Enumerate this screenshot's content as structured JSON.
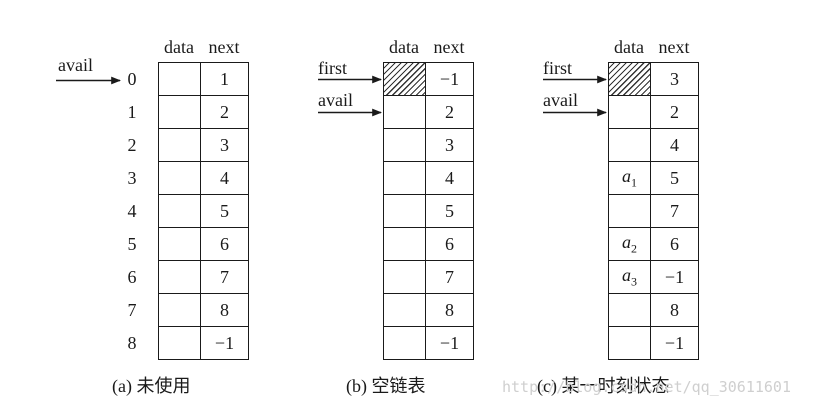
{
  "column_headers": {
    "data": "data",
    "next": "next"
  },
  "tables": [
    {
      "caption": "(a) 未使用",
      "pointers": [
        {
          "label": "avail",
          "row": 0
        }
      ],
      "show_indices": true,
      "indices": [
        "0",
        "1",
        "2",
        "3",
        "4",
        "5",
        "6",
        "7",
        "8"
      ],
      "rows": [
        {
          "data": "",
          "next": "1"
        },
        {
          "data": "",
          "next": "2"
        },
        {
          "data": "",
          "next": "3"
        },
        {
          "data": "",
          "next": "4"
        },
        {
          "data": "",
          "next": "5"
        },
        {
          "data": "",
          "next": "6"
        },
        {
          "data": "",
          "next": "7"
        },
        {
          "data": "",
          "next": "8"
        },
        {
          "data": "",
          "next": "−1"
        }
      ]
    },
    {
      "caption": "(b) 空链表",
      "pointers": [
        {
          "label": "first",
          "row": 0
        },
        {
          "label": "avail",
          "row": 1
        }
      ],
      "show_indices": false,
      "rows": [
        {
          "data": "",
          "next": "−1",
          "hatched": true
        },
        {
          "data": "",
          "next": "2"
        },
        {
          "data": "",
          "next": "3"
        },
        {
          "data": "",
          "next": "4"
        },
        {
          "data": "",
          "next": "5"
        },
        {
          "data": "",
          "next": "6"
        },
        {
          "data": "",
          "next": "7"
        },
        {
          "data": "",
          "next": "8"
        },
        {
          "data": "",
          "next": "−1"
        }
      ]
    },
    {
      "caption": "(c) 某一时刻状态",
      "pointers": [
        {
          "label": "first",
          "row": 0
        },
        {
          "label": "avail",
          "row": 1
        }
      ],
      "show_indices": false,
      "rows": [
        {
          "data": "",
          "next": "3",
          "hatched": true
        },
        {
          "data": "",
          "next": "2"
        },
        {
          "data": "",
          "next": "4"
        },
        {
          "data": "a",
          "sub": "1",
          "next": "5"
        },
        {
          "data": "",
          "next": "7"
        },
        {
          "data": "a",
          "sub": "2",
          "next": "6"
        },
        {
          "data": "a",
          "sub": "3",
          "next": "−1"
        },
        {
          "data": "",
          "next": "8"
        },
        {
          "data": "",
          "next": "−1"
        }
      ]
    }
  ],
  "watermark": "http://blog.csdn.net/qq_30611601"
}
